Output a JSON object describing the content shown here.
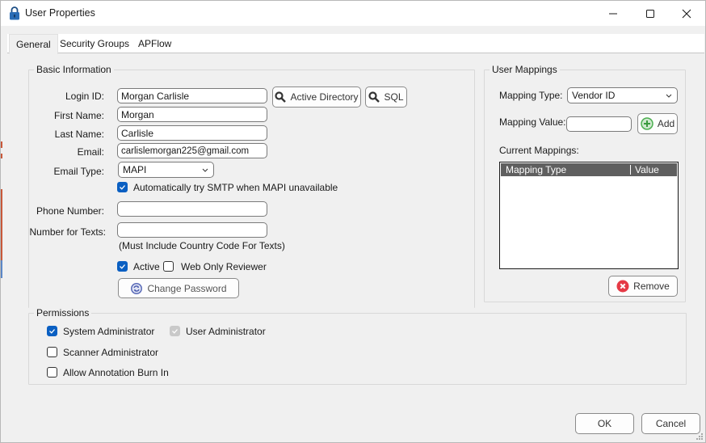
{
  "window": {
    "title": "User Properties",
    "icon": "padlock-icon",
    "controls": {
      "minimize": "minimize-icon",
      "maximize": "maximize-icon",
      "close": "close-icon"
    }
  },
  "tabs": [
    {
      "label": "General",
      "active": true
    },
    {
      "label": "Security Groups",
      "active": false
    },
    {
      "label": "APFlow",
      "active": false
    }
  ],
  "basic_info": {
    "title": "Basic Information",
    "login_id": {
      "label": "Login ID:",
      "value": "Morgan Carlisle"
    },
    "first_name": {
      "label": "First Name:",
      "value": "Morgan"
    },
    "last_name": {
      "label": "Last Name:",
      "value": "Carlisle"
    },
    "email": {
      "label": "Email:",
      "value": "carlislemorgan225@gmail.com"
    },
    "email_type": {
      "label": "Email Type:",
      "value": "MAPI"
    },
    "auto_smtp": {
      "label": "Automatically try SMTP when MAPI unavailable",
      "checked": true
    },
    "phone": {
      "label": "Phone Number:",
      "value": ""
    },
    "text_number": {
      "label": "Number for Texts:",
      "value": ""
    },
    "text_hint": "(Must Include Country Code For Texts)",
    "active": {
      "label": "Active",
      "checked": true
    },
    "web_only": {
      "label": "Web Only Reviewer",
      "checked": false
    },
    "active_directory_button": "Active Directory",
    "sql_button": "SQL",
    "change_password_button": "Change Password"
  },
  "user_mappings": {
    "title": "User Mappings",
    "mapping_type": {
      "label": "Mapping Type:",
      "value": "Vendor ID"
    },
    "mapping_value": {
      "label": "Mapping Value:",
      "value": ""
    },
    "add_button": "Add",
    "current_label": "Current Mappings:",
    "columns": [
      "Mapping Type",
      "Value"
    ],
    "rows": [],
    "remove_button": "Remove"
  },
  "permissions": {
    "title": "Permissions",
    "items": [
      {
        "label": "System Administrator",
        "checked": true,
        "enabled": true
      },
      {
        "label": "User Administrator",
        "checked": true,
        "enabled": false
      },
      {
        "label": "Scanner Administrator",
        "checked": false,
        "enabled": true
      },
      {
        "label": "Allow Annotation Burn In",
        "checked": false,
        "enabled": true
      }
    ]
  },
  "footer": {
    "ok": "OK",
    "cancel": "Cancel"
  },
  "colors": {
    "checkbox_on": "#0a5fc2",
    "checkbox_disabled": "#c9c9c9",
    "list_header": "#5f5f5f",
    "add_icon": "#4caf50",
    "remove_icon": "#e53945",
    "refresh_icon": "#4a5cb0"
  }
}
